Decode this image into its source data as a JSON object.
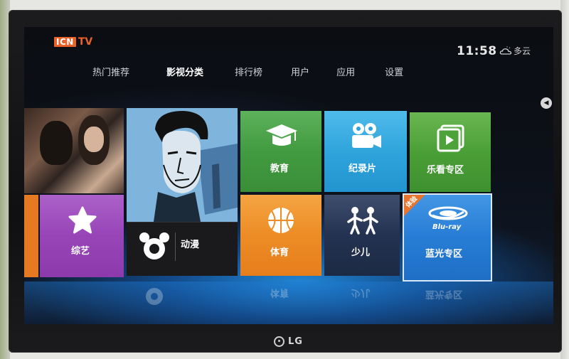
{
  "app": {
    "logo_box": "ICN",
    "logo_tv": "TV"
  },
  "status": {
    "time": "11:58",
    "weather": "多云",
    "weather_icon": "cloud-sun-icon"
  },
  "nav": {
    "items": [
      {
        "label": "热门推荐",
        "active": false
      },
      {
        "label": "影视分类",
        "active": true
      },
      {
        "label": "排行榜",
        "active": false
      },
      {
        "label": "用户",
        "active": false
      },
      {
        "label": "应用",
        "active": false
      },
      {
        "label": "设置",
        "active": false
      }
    ]
  },
  "tiles": {
    "education": {
      "label": "教育",
      "icon": "graduation-cap-icon",
      "color": "#3f9a3c"
    },
    "documentary": {
      "label": "纪录片",
      "icon": "film-camera-icon",
      "color": "#2aa3dc"
    },
    "le_kan": {
      "label": "乐看专区",
      "icon": "play-icon",
      "color": "#4ea23a"
    },
    "variety": {
      "label": "综艺",
      "icon": "star-icon",
      "color": "#9a46b8"
    },
    "anime": {
      "label": "动漫",
      "icon": "mouse-face-icon",
      "color": "#1a1a1a"
    },
    "sports": {
      "label": "体育",
      "icon": "basketball-icon",
      "color": "#f08a23"
    },
    "kids": {
      "label": "少儿",
      "icon": "children-icon",
      "color": "#22314f"
    },
    "bluray": {
      "label": "蓝光专区",
      "icon": "bluray-logo-icon",
      "color": "#2479d3",
      "badge": "体验",
      "logo_text": "Blu-ray"
    }
  },
  "device": {
    "brand": "LG"
  }
}
